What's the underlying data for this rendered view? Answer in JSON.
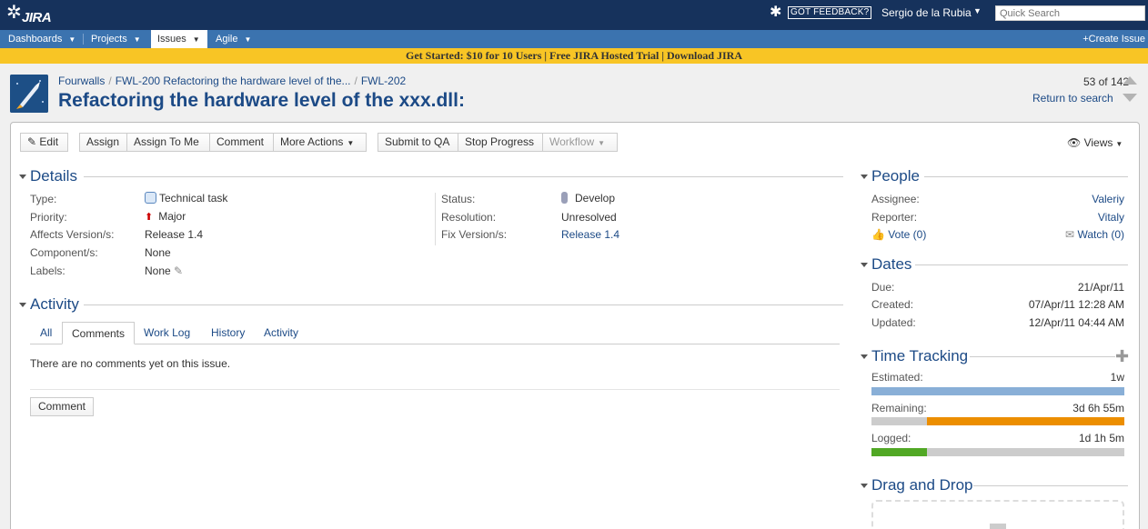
{
  "header": {
    "logo_text": "JIRA",
    "feedback": "GOT FEEDBACK?",
    "user": "Sergio de la Rubia",
    "search_placeholder": "Quick Search"
  },
  "nav": {
    "items": [
      {
        "label": "Dashboards"
      },
      {
        "label": "Projects"
      },
      {
        "label": "Issues"
      },
      {
        "label": "Agile"
      }
    ],
    "create": "Create Issue"
  },
  "banner": "Get Started: $10 for 10 Users | Free JIRA Hosted Trial | Download JIRA",
  "issue": {
    "breadcrumb": [
      "Fourwalls",
      "FWL-200 Refactoring the hardware level of the...",
      "FWL-202"
    ],
    "summary": "Refactoring the hardware level of the xxx.dll:",
    "pager": "53 of 142",
    "return_search": "Return to search"
  },
  "toolbar": {
    "edit": "Edit",
    "assign": "Assign",
    "assign_to_me": "Assign To Me",
    "comment": "Comment",
    "more_actions": "More Actions",
    "submit_qa": "Submit to QA",
    "stop_progress": "Stop Progress",
    "workflow": "Workflow",
    "views": "Views"
  },
  "details": {
    "title": "Details",
    "type_label": "Type:",
    "type": "Technical task",
    "priority_label": "Priority:",
    "priority": "Major",
    "affects_label": "Affects Version/s:",
    "affects": "Release 1.4",
    "component_label": "Component/s:",
    "component": "None",
    "labels_label": "Labels:",
    "labels": "None",
    "status_label": "Status:",
    "status": "Develop",
    "resolution_label": "Resolution:",
    "resolution": "Unresolved",
    "fix_label": "Fix Version/s:",
    "fix": "Release 1.4"
  },
  "activity": {
    "title": "Activity",
    "tabs": [
      "All",
      "Comments",
      "Work Log",
      "History",
      "Activity"
    ],
    "empty": "There are no comments yet on this issue.",
    "comment_button": "Comment"
  },
  "people": {
    "title": "People",
    "assignee_label": "Assignee:",
    "assignee": "Valeriy",
    "reporter_label": "Reporter:",
    "reporter": "Vitaly",
    "vote": "Vote (0)",
    "watch": "Watch (0)"
  },
  "dates": {
    "title": "Dates",
    "due_label": "Due:",
    "due": "21/Apr/11",
    "created_label": "Created:",
    "created": "07/Apr/11 12:28 AM",
    "updated_label": "Updated:",
    "updated": "12/Apr/11 04:44 AM"
  },
  "time_tracking": {
    "title": "Time Tracking",
    "estimated_label": "Estimated:",
    "estimated": "1w",
    "remaining_label": "Remaining:",
    "remaining": "3d 6h 55m",
    "logged_label": "Logged:",
    "logged": "1d 1h 5m",
    "estimated_fraction": 1.0,
    "remaining_fraction": 0.78,
    "logged_fraction": 0.22,
    "colors": {
      "estimated": "#89afd7",
      "remaining": "#ec8e00",
      "logged": "#51a825",
      "empty": "#cccccc"
    }
  },
  "drag_drop": {
    "title": "Drag and Drop"
  }
}
